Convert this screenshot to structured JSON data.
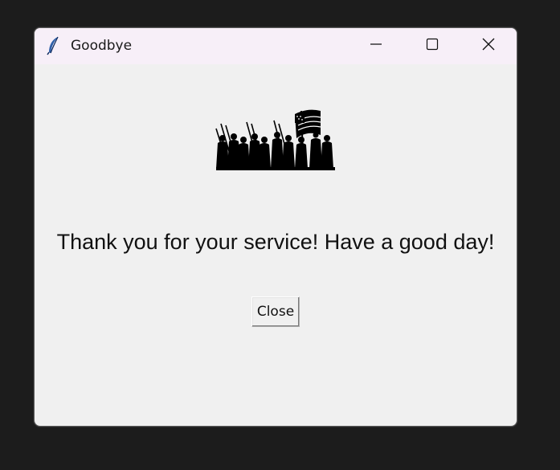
{
  "window": {
    "title": "Goodbye",
    "app_icon": "feather-icon",
    "controls": {
      "minimize": "minimize-icon",
      "maximize": "maximize-icon",
      "close": "close-icon"
    }
  },
  "content": {
    "image": "marching-soldiers-flag-silhouette",
    "message": "Thank you for your service! Have a good day!",
    "close_button_label": "Close"
  },
  "colors": {
    "desktop": "#1c1c1c",
    "titlebar": "#f7eff8",
    "window_bg": "#f0f0f0",
    "text": "#111111"
  }
}
